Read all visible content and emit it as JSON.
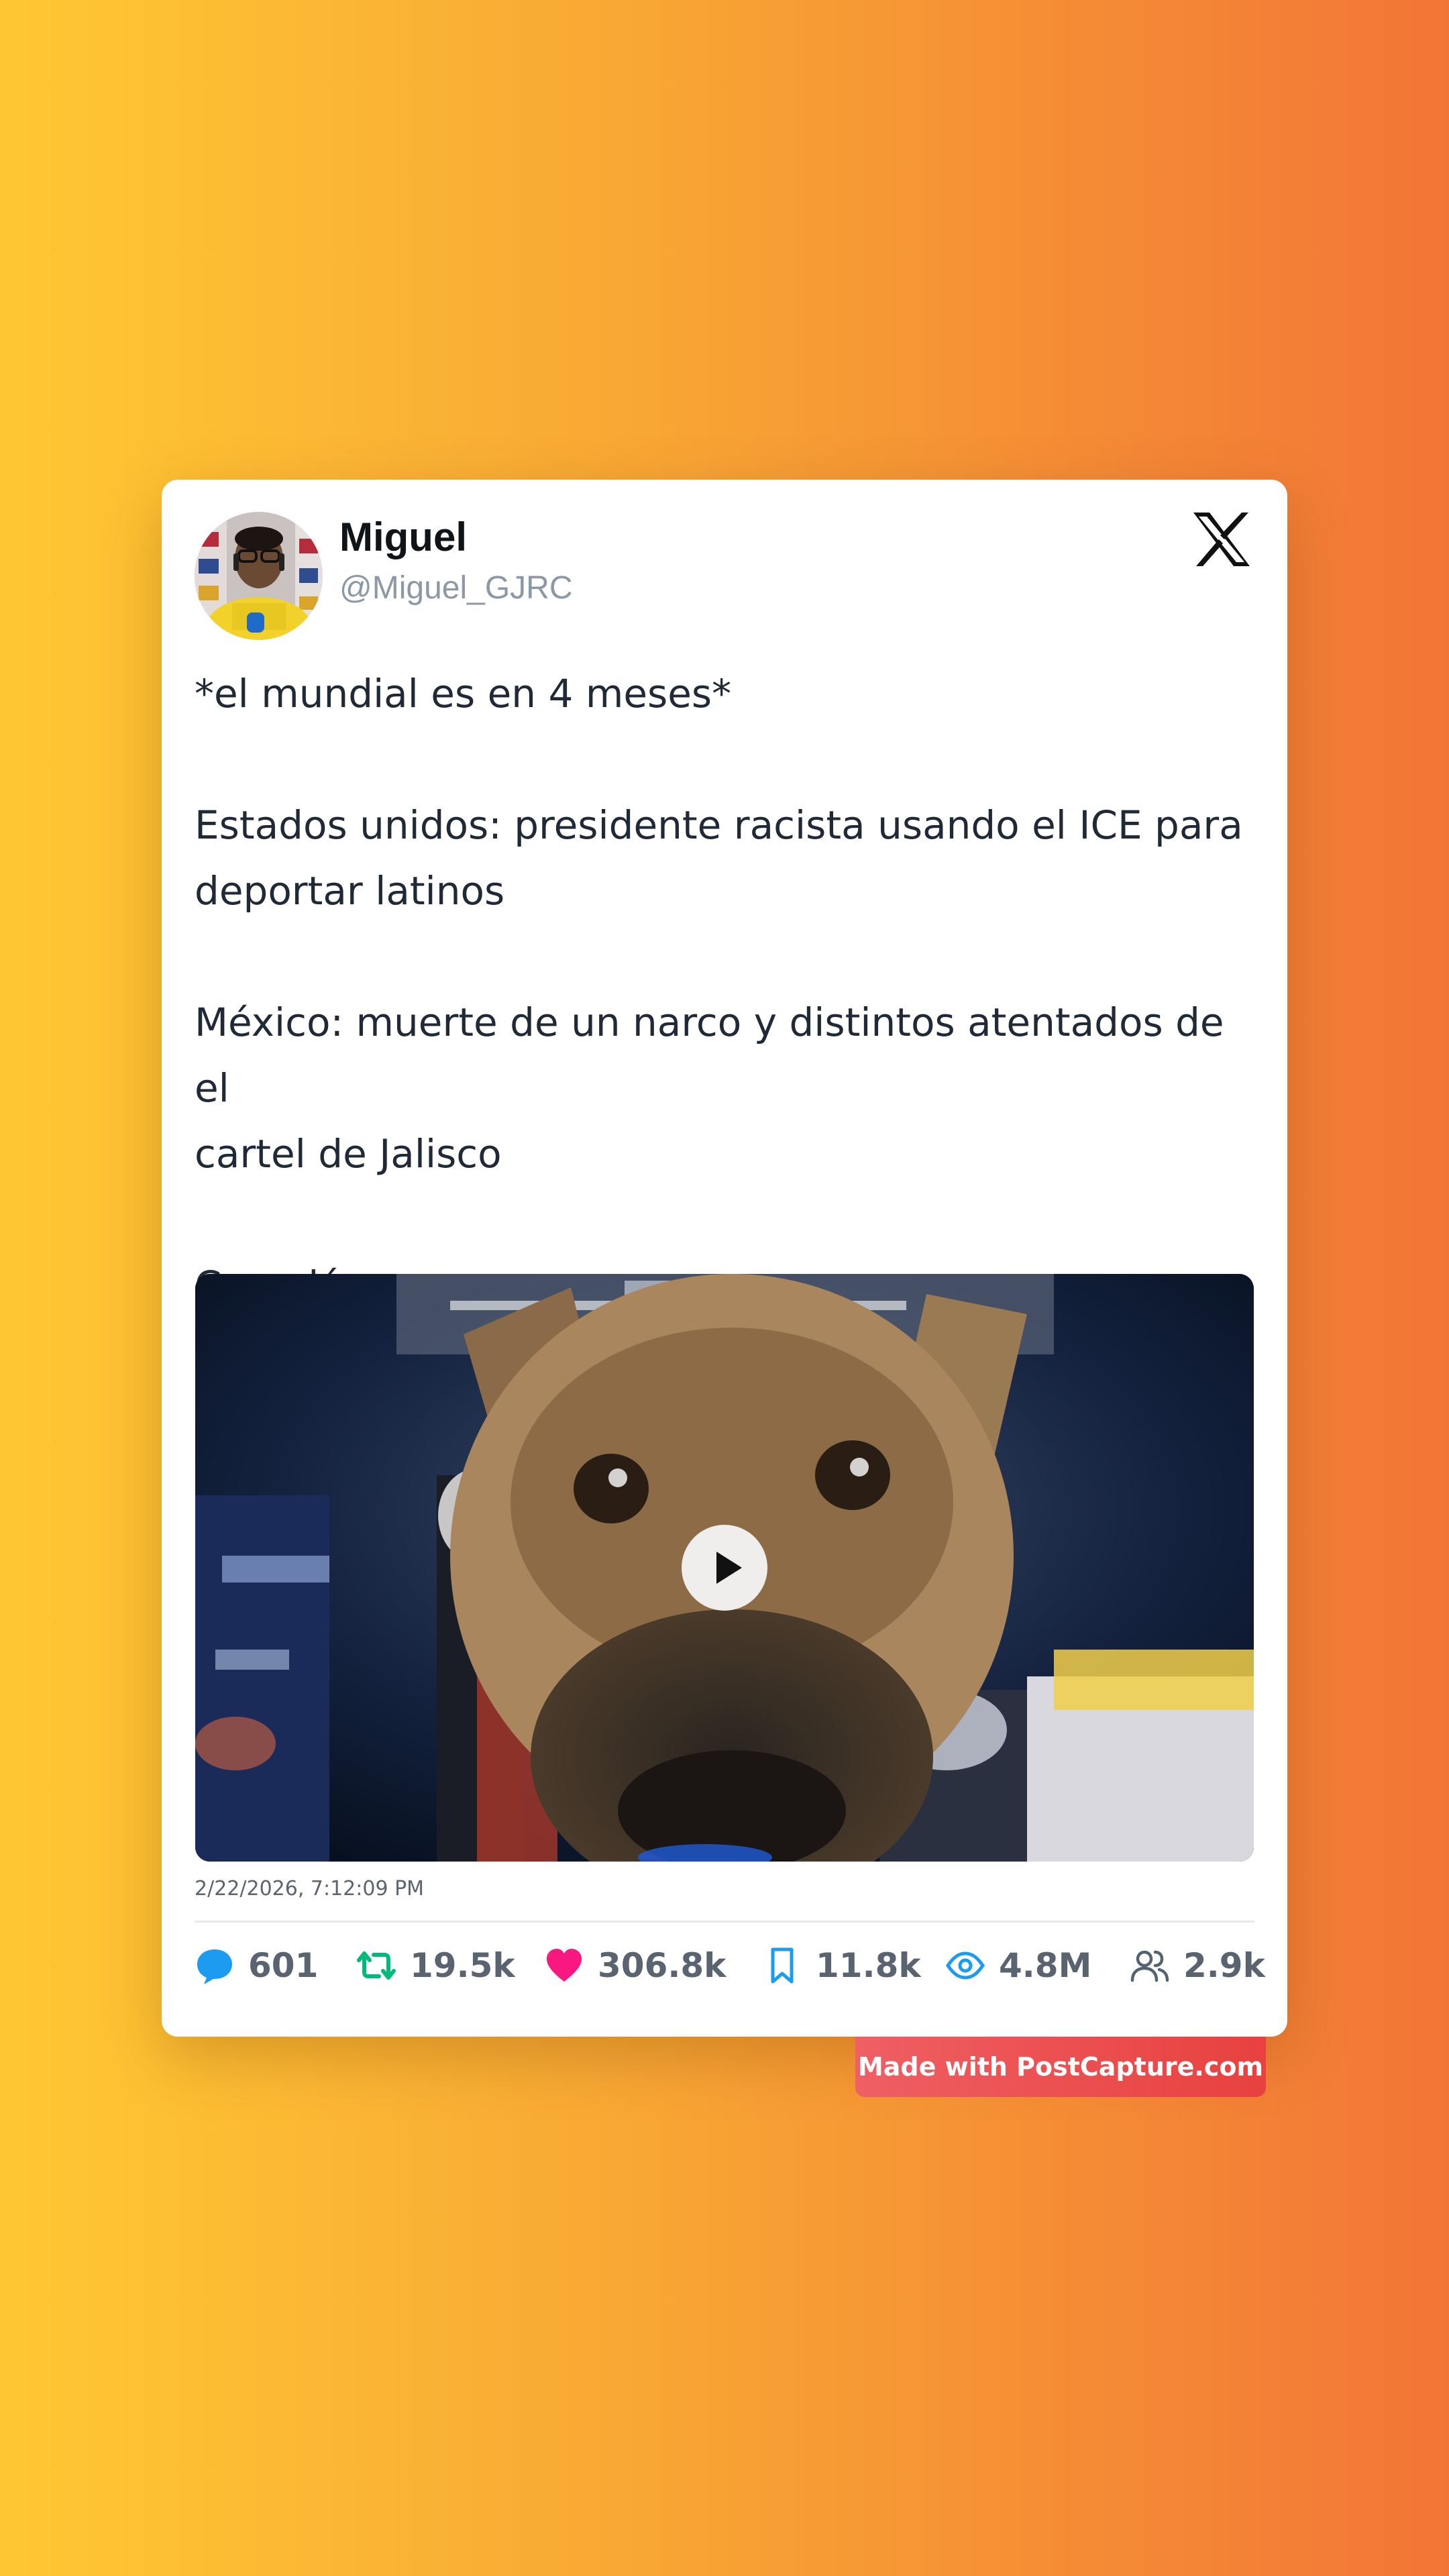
{
  "post": {
    "author_name": "Miguel",
    "author_handle": "@Miguel_GJRC",
    "text_lines": [
      "*el mundial es en 4 meses*",
      "Estados unidos: presidente racista usando el ICE para",
      "deportar latinos",
      "México: muerte de un narco y distintos atentados de el",
      "cartel de Jalisco",
      "Canadá:"
    ],
    "timestamp": "2/22/2026, 7:12:09 PM",
    "media_type": "video"
  },
  "stats": {
    "replies": "601",
    "reposts": "19.5k",
    "likes": "306.8k",
    "bookmarks": "11.8k",
    "views": "4.8M",
    "followers": "2.9k"
  },
  "icons": {
    "platform": "x-logo-icon",
    "reply": "comment-bubble-icon",
    "repost": "repost-icon",
    "like": "heart-icon",
    "bookmark": "bookmark-icon",
    "views": "eye-icon",
    "followers": "users-icon",
    "play": "play-icon"
  },
  "colors": {
    "reply": "#1d9bf0",
    "repost": "#00ba7c",
    "like": "#f91880",
    "bookmark": "#1d9bf0",
    "views": "#1d9bf0",
    "followers": "#536471",
    "watermark": "#e94a4a",
    "background_start": "#ffc833",
    "background_end": "#f27536"
  },
  "watermark": {
    "text": "Made with PostCapture.com"
  }
}
